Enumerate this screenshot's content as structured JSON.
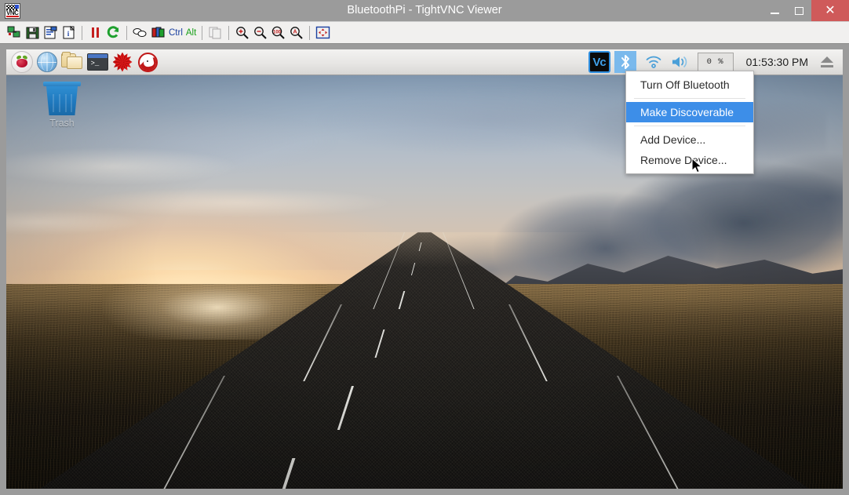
{
  "window": {
    "title": "BluetoothPi - TightVNC Viewer",
    "app_icon": "vnc-icon",
    "icon_letters": "VNC",
    "controls": {
      "minimize": "minimize-icon",
      "maximize": "maximize-icon",
      "close_glyph": "✕"
    }
  },
  "toolbar": {
    "items": [
      {
        "name": "new-connection-icon",
        "glyph": "new"
      },
      {
        "name": "save-session-icon",
        "glyph": "save"
      },
      {
        "name": "connection-options-icon",
        "glyph": "options"
      },
      {
        "name": "connection-info-icon",
        "glyph": "info"
      },
      {
        "name": "pause-updates-icon",
        "glyph": "pause"
      },
      {
        "name": "refresh-screen-icon",
        "glyph": "refresh"
      },
      {
        "name": "send-ctrl-alt-del-icon",
        "glyph": "cad"
      },
      {
        "name": "send-keys-icon",
        "glyph": "keys"
      },
      {
        "name": "clipboard-icon",
        "glyph": "clipboard"
      },
      {
        "name": "zoom-in-icon",
        "glyph": "zoom-in"
      },
      {
        "name": "zoom-out-icon",
        "glyph": "zoom-out"
      },
      {
        "name": "zoom-100-icon",
        "glyph": "zoom-100"
      },
      {
        "name": "zoom-auto-icon",
        "glyph": "zoom-auto"
      },
      {
        "name": "fullscreen-icon",
        "glyph": "fullscreen"
      }
    ],
    "ctrl_label": "Ctrl",
    "alt_label": "Alt"
  },
  "remote_desktop": {
    "taskbar": {
      "launchers": [
        {
          "name": "menu-button",
          "label": "Menu"
        },
        {
          "name": "web-browser-button",
          "label": "Web Browser"
        },
        {
          "name": "file-manager-button",
          "label": "File Manager"
        },
        {
          "name": "terminal-button",
          "label": "Terminal"
        },
        {
          "name": "mathematica-button",
          "label": "Mathematica"
        },
        {
          "name": "wolfram-button",
          "label": "Wolfram"
        }
      ],
      "tray": {
        "vnc_label": "Vc",
        "bluetooth_name": "bluetooth-icon",
        "wifi_name": "wifi-icon",
        "volume_name": "volume-icon",
        "cpu_text": "0 %",
        "clock": "01:53:30 PM",
        "eject_name": "eject-icon"
      }
    },
    "desktop": {
      "trash_label": "Trash"
    },
    "bluetooth_menu": {
      "items": [
        {
          "label": "Turn Off Bluetooth",
          "selected": false,
          "separator_after": true
        },
        {
          "label": "Make Discoverable",
          "selected": true,
          "separator_after": true
        },
        {
          "label": "Add Device...",
          "selected": false,
          "separator_after": false
        },
        {
          "label": "Remove Device...",
          "selected": false,
          "separator_after": false
        }
      ]
    }
  },
  "colors": {
    "titlebar_bg": "#9b9b9b",
    "close_button": "#cf5a5a",
    "toolbar_bg": "#f1f0ef",
    "menu_highlight": "#3d8ee8",
    "bluetooth_tray_bg": "#7ab9ec",
    "trash_blue": "#1f78bd"
  }
}
